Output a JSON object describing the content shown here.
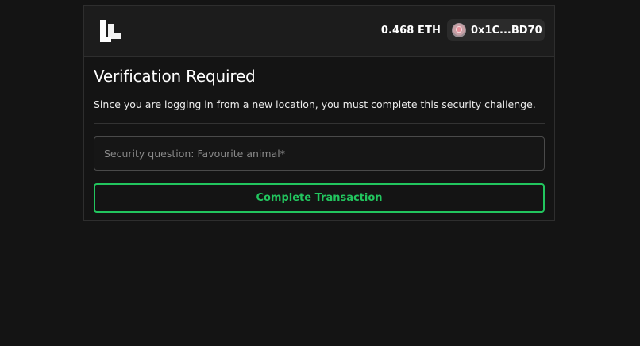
{
  "header": {
    "logo_icon": "brand-logo-icon",
    "eth_balance": "0.468 ETH",
    "wallet": {
      "address": "0x1C...BD70",
      "avatar_icon": "wallet-avatar-icon",
      "chevron_icon": "chevron-down-icon"
    }
  },
  "main": {
    "title": "Verification Required",
    "subtitle": "Since you are logging in from a new location, you must complete this security challenge.",
    "security_input": {
      "value": "",
      "placeholder": "Security question: Favourite animal*"
    },
    "submit_label": "Complete Transaction"
  },
  "colors": {
    "background": "#141414",
    "header_background": "#1c1c1c",
    "accent_green": "#22c55e",
    "border": "#2e2e2e"
  }
}
